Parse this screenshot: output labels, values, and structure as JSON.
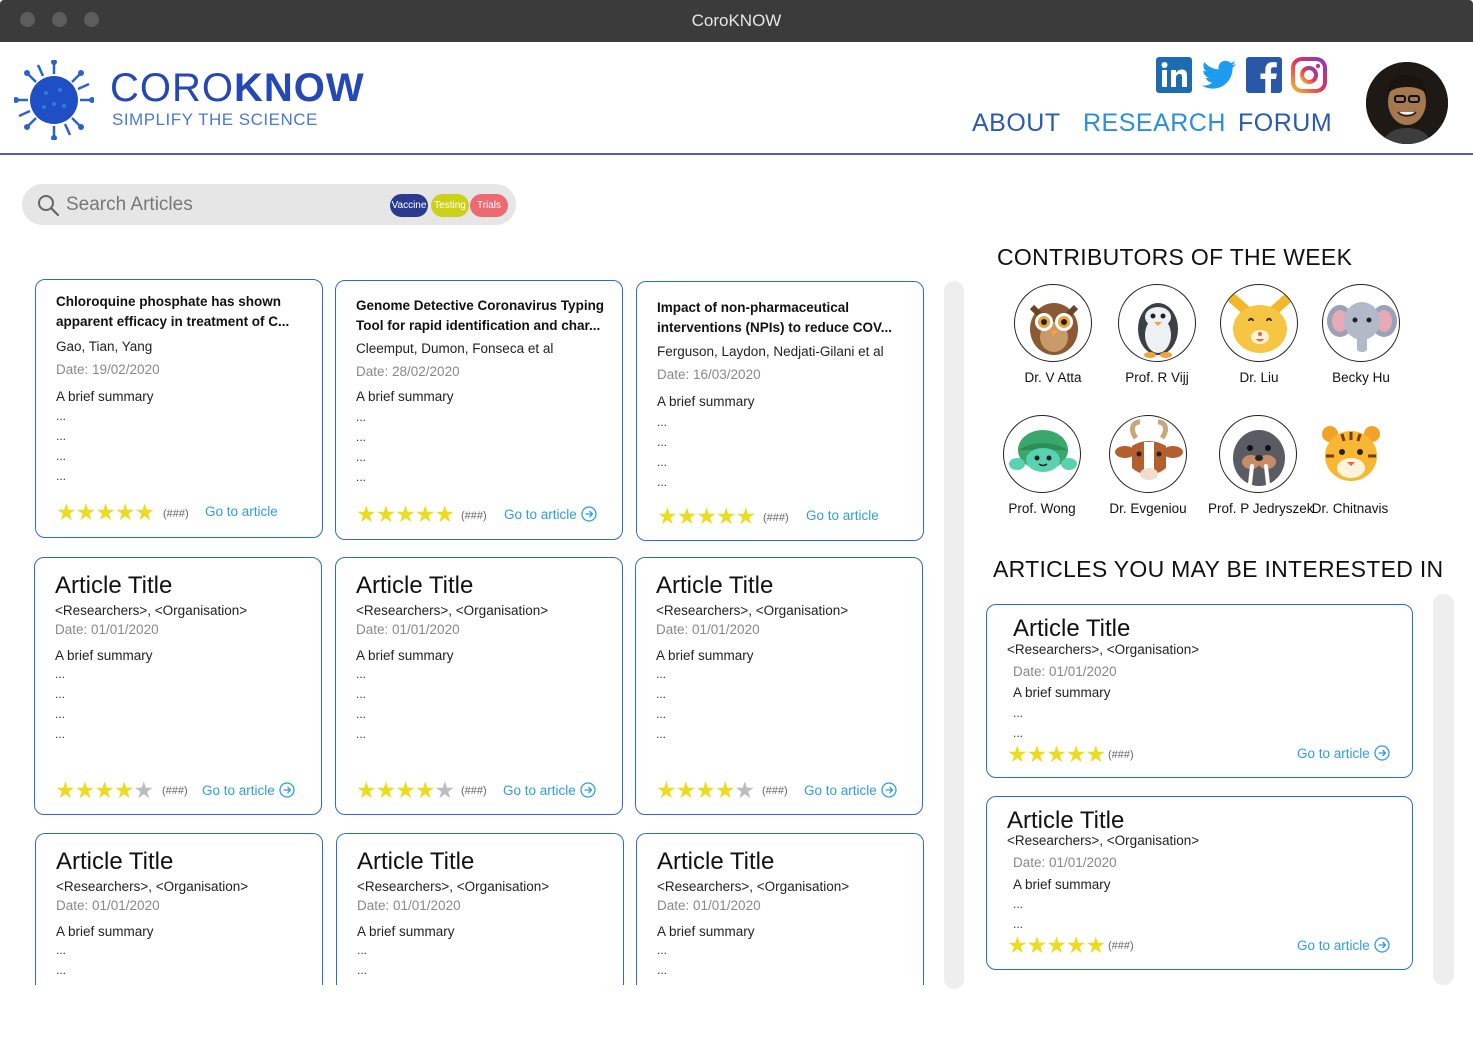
{
  "window": {
    "title": "CoroKNOW"
  },
  "header": {
    "brand_light": "CORO",
    "brand_bold": "KNOW",
    "tagline": "SIMPLIFY THE SCIENCE",
    "nav": {
      "about": "ABOUT",
      "research": "RESEARCH",
      "forum": "FORUM"
    },
    "social_icons": [
      "linkedin-icon",
      "twitter-icon",
      "facebook-icon",
      "instagram-icon"
    ]
  },
  "search": {
    "placeholder": "Search Articles",
    "tags": [
      {
        "label": "Vaccine",
        "color": "#2a3b8f"
      },
      {
        "label": "Testing",
        "color": "#cdd019"
      },
      {
        "label": "Trials",
        "color": "#ec6b73"
      }
    ]
  },
  "colors": {
    "accent": "#2e6bd1",
    "link": "#2e9ee0",
    "star": "#ecdc21",
    "brand": "#2549b4"
  },
  "articles": [
    {
      "title_l1": "Chloroquine phosphate has shown",
      "title_l2": "apparent efficacy in treatment of C...",
      "authors": "Gao, Tian, Yang",
      "date": "Date: 19/02/2020",
      "summary": "A brief summary",
      "rating": 5,
      "count": "(###)",
      "link": "Go to article"
    },
    {
      "title_l1": "Genome Detective Coronavirus Typing",
      "title_l2": "Tool for rapid identification and char...",
      "authors": "Cleemput, Dumon, Fonseca et al",
      "date": "Date: 28/02/2020",
      "summary": "A brief summary",
      "rating": 5,
      "count": "(###)",
      "link": "Go to article"
    },
    {
      "title_l1": "Impact of non-pharmaceutical",
      "title_l2": "interventions (NPIs) to reduce COV...",
      "authors": "Ferguson, Laydon, Nedjati-Gilani et al",
      "date": "Date: 16/03/2020",
      "summary": "A brief summary",
      "rating": 5,
      "count": "(###)",
      "link": "Go to article"
    },
    {
      "title": "Article Title",
      "authors": "<Researchers>, <Organisation>",
      "date": "Date: 01/01/2020",
      "summary": "A brief summary",
      "rating": 4,
      "count": "(###)",
      "link": "Go to article"
    },
    {
      "title": "Article Title",
      "authors": "<Researchers>, <Organisation>",
      "date": "Date: 01/01/2020",
      "summary": "A brief summary",
      "rating": 4,
      "count": "(###)",
      "link": "Go to article"
    },
    {
      "title": "Article Title",
      "authors": "<Researchers>, <Organisation>",
      "date": "Date: 01/01/2020",
      "summary": "A brief summary",
      "rating": 4,
      "count": "(###)",
      "link": "Go to article"
    },
    {
      "title": "Article Title",
      "authors": "<Researchers>, <Organisation>",
      "date": "Date: 01/01/2020",
      "summary": "A brief summary"
    },
    {
      "title": "Article Title",
      "authors": "<Researchers>, <Organisation>",
      "date": "Date: 01/01/2020",
      "summary": "A brief summary"
    },
    {
      "title": "Article Title",
      "authors": "<Researchers>, <Organisation>",
      "date": "Date: 01/01/2020",
      "summary": "A brief summary"
    }
  ],
  "ellipsis": "...",
  "contributors": {
    "heading": "CONTRIBUTORS OF THE WEEK",
    "people": [
      {
        "name": "Dr. V Atta",
        "icon": "owl-icon"
      },
      {
        "name": "Prof. R Vijj",
        "icon": "penguin-icon"
      },
      {
        "name": "Dr. Liu",
        "icon": "cat-icon"
      },
      {
        "name": "Becky Hu",
        "icon": "elephant-icon"
      },
      {
        "name": "Prof. Wong",
        "icon": "turtle-icon"
      },
      {
        "name": "Dr. Evgeniou",
        "icon": "goat-icon"
      },
      {
        "name": "Prof. P Jedryszek",
        "icon": "walrus-icon"
      },
      {
        "name": "Dr. Chitnavis",
        "icon": "tiger-icon"
      }
    ]
  },
  "interested": {
    "heading": "ARTICLES YOU MAY BE INTERESTED IN",
    "items": [
      {
        "title": "Article Title",
        "authors": "<Researchers>, <Organisation>",
        "date": "Date: 01/01/2020",
        "summary": "A brief summary",
        "rating": 5,
        "count": "(###)",
        "link": "Go to article"
      },
      {
        "title": "Article Title",
        "authors": "<Researchers>, <Organisation>",
        "date": "Date: 01/01/2020",
        "summary": "A brief summary",
        "rating": 5,
        "count": "(###)",
        "link": "Go to article"
      }
    ]
  }
}
